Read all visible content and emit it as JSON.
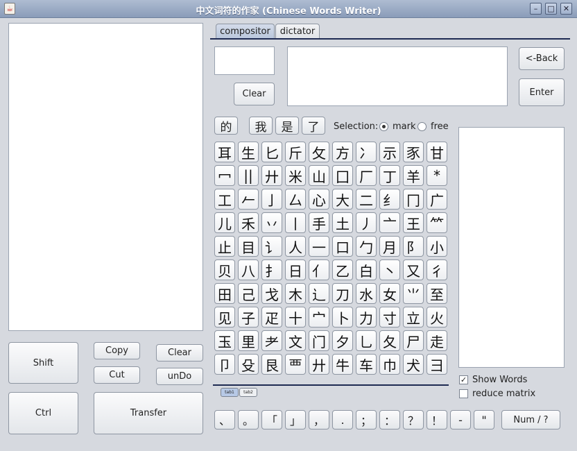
{
  "window": {
    "title": "中文词符的作家 (Chinese Words Writer)",
    "app_icon": "java-icon",
    "controls": [
      "minimize-icon",
      "maximize-icon",
      "close-icon"
    ]
  },
  "tabs": [
    {
      "label": "compositor",
      "active": true
    },
    {
      "label": "dictator",
      "active": false
    }
  ],
  "compose": {
    "input_value": "",
    "text_value": "",
    "clear_label": "Clear",
    "back_label": "<-Back",
    "enter_label": "Enter"
  },
  "quick_words": [
    "的",
    "我",
    "是",
    "了"
  ],
  "selection": {
    "label": "Selection:",
    "options": [
      {
        "label": "mark",
        "selected": true
      },
      {
        "label": "free",
        "selected": false
      }
    ]
  },
  "radicals": [
    [
      "耳",
      "生",
      "匕",
      "斤",
      "攵",
      "方",
      "冫",
      "示",
      "豕",
      "甘"
    ],
    [
      "冖",
      "||",
      "廾",
      "米",
      "山",
      "囗",
      "厂",
      "丁",
      "羊",
      "*"
    ],
    [
      "工",
      "𠂉",
      "亅",
      "厶",
      "心",
      "大",
      "二",
      "纟",
      "冂",
      "广"
    ],
    [
      "儿",
      "禾",
      "丷",
      "丨",
      "手",
      "土",
      "丿",
      "亠",
      "王",
      "⺮"
    ],
    [
      "止",
      "目",
      "讠",
      "人",
      "一",
      "口",
      "勹",
      "月",
      "阝",
      "小"
    ],
    [
      "贝",
      "八",
      "扌",
      "日",
      "亻",
      "乙",
      "白",
      "丶",
      "又",
      "彳"
    ],
    [
      "田",
      "己",
      "戈",
      "木",
      "辶",
      "刀",
      "水",
      "女",
      "⺌",
      "至"
    ],
    [
      "见",
      "子",
      "疋",
      "十",
      "宀",
      "卜",
      "力",
      "寸",
      "立",
      "火"
    ],
    [
      "玉",
      "里",
      "耂",
      "文",
      "门",
      "夕",
      "乚",
      "夂",
      "尸",
      "走"
    ],
    [
      "卩",
      "殳",
      "艮",
      "覀",
      "廾",
      "牛",
      "车",
      "巾",
      "犬",
      "彐"
    ]
  ],
  "mini_tabs": [
    {
      "label": "tab1",
      "active": true
    },
    {
      "label": "tab2",
      "active": false
    }
  ],
  "options": {
    "show_words": {
      "label": "Show Words",
      "checked": true
    },
    "reduce_matrix": {
      "label": "reduce matrix",
      "checked": false
    }
  },
  "punctuation": [
    "、",
    "。",
    "「",
    "」",
    "，",
    ".",
    "；",
    "：",
    "？",
    "！",
    "-",
    "\""
  ],
  "num_label": "Num / ?",
  "actions": {
    "shift": "Shift",
    "ctrl": "Ctrl",
    "copy": "Copy",
    "cut": "Cut",
    "clear": "Clear",
    "undo": "unDo",
    "transfer": "Transfer"
  }
}
